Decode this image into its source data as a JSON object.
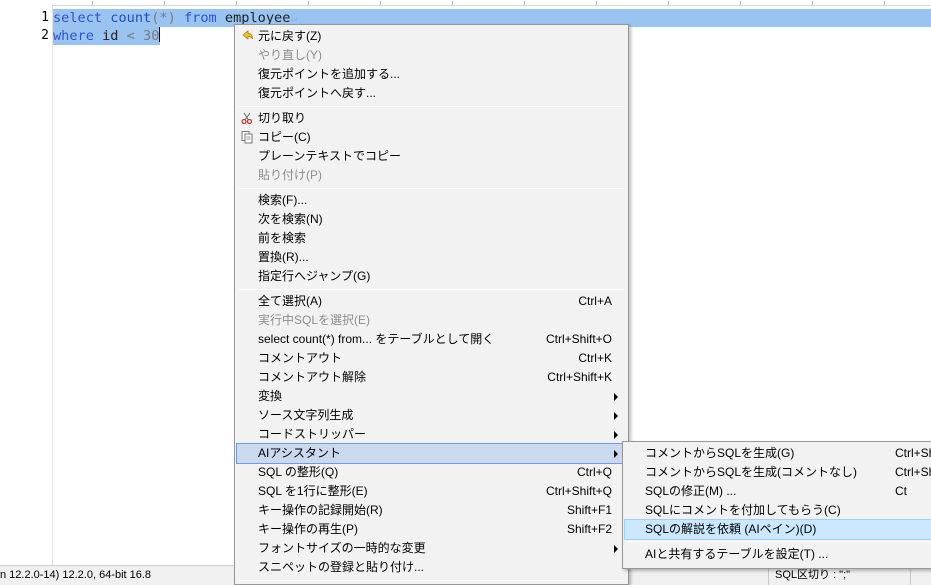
{
  "editor": {
    "line_numbers": [
      "1",
      "2"
    ],
    "line1": {
      "t1": "select",
      "t2": "count",
      "t3": "(*)",
      "t4": "from",
      "t5": "employee",
      "eol": "↵"
    },
    "line2": {
      "t1": "where",
      "t2": "id",
      "t3": "<",
      "t4": "30"
    }
  },
  "context_menu": {
    "items": [
      {
        "label": "元に戻す(Z)",
        "icon": "undo-icon"
      },
      {
        "label": "やり直し(Y)",
        "disabled": true
      },
      {
        "label": "復元ポイントを追加する..."
      },
      {
        "label": "復元ポイントへ戻す..."
      },
      {
        "label": "切り取り",
        "icon": "scissors-icon"
      },
      {
        "label": "コピー(C)",
        "icon": "copy-icon"
      },
      {
        "label": "プレーンテキストでコピー"
      },
      {
        "label": "貼り付け(P)",
        "disabled": true
      },
      {
        "label": "検索(F)..."
      },
      {
        "label": "次を検索(N)"
      },
      {
        "label": "前を検索"
      },
      {
        "label": "置換(R)..."
      },
      {
        "label": "指定行へジャンプ(G)"
      },
      {
        "label": "全て選択(A)",
        "shortcut": "Ctrl+A"
      },
      {
        "label": "実行中SQLを選択(E)",
        "disabled": true
      },
      {
        "label": "select count(*) from... をテーブルとして開く",
        "shortcut": "Ctrl+Shift+O"
      },
      {
        "label": "コメントアウト",
        "shortcut": "Ctrl+K"
      },
      {
        "label": "コメントアウト解除",
        "shortcut": "Ctrl+Shift+K"
      },
      {
        "label": "変換",
        "submenu": true
      },
      {
        "label": "ソース文字列生成",
        "submenu": true
      },
      {
        "label": "コードストリッパー",
        "submenu": true
      },
      {
        "label": "AIアシスタント",
        "submenu": true,
        "highlighted": true
      },
      {
        "label": "SQL の整形(Q)",
        "shortcut": "Ctrl+Q"
      },
      {
        "label": "SQL を1行に整形(E)",
        "shortcut": "Ctrl+Shift+Q"
      },
      {
        "label": "キー操作の記録開始(R)",
        "shortcut": "Shift+F1"
      },
      {
        "label": "キー操作の再生(P)",
        "shortcut": "Shift+F2"
      },
      {
        "label": "フォントサイズの一時的な変更",
        "submenu": true
      },
      {
        "label": "スニペットの登録と貼り付け..."
      }
    ]
  },
  "ai_submenu": {
    "items": [
      {
        "label": "コメントからSQLを生成(G)",
        "shortcut": "Ctrl+Sh"
      },
      {
        "label": "コメントからSQLを生成(コメントなし)",
        "shortcut": "Ctrl+Sh"
      },
      {
        "label": "SQLの修正(M) ...",
        "shortcut": "Ct"
      },
      {
        "label": "SQLにコメントを付加してもらう(C)"
      },
      {
        "label": "SQLの解説を依頼 (AIペイン)(D)",
        "highlighted": true
      },
      {
        "label": "AIと共有するテーブルを設定(T) ..."
      }
    ]
  },
  "statusbar": {
    "version_text": "n 12.2.0-14) 12.2.0, 64-bit 16.8",
    "sql_delimiter": "SQL区切り : \";\""
  },
  "colors": {
    "selection": "#99c4f2",
    "keyword": "#2d52d6",
    "menu_background": "#f2f2f2",
    "menu_highlight": "#cce8ff"
  }
}
